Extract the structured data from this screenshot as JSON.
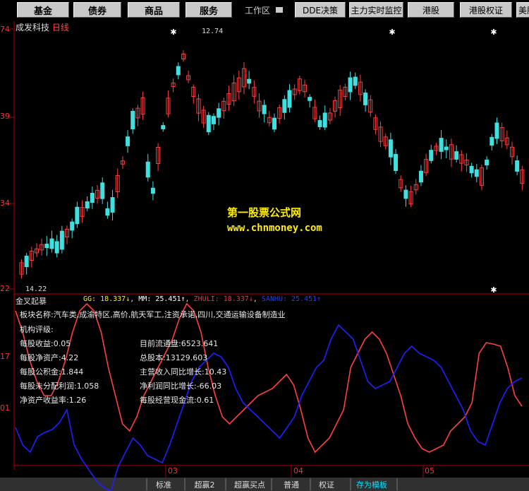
{
  "toolbar": {
    "buttons": [
      "基金",
      "债券",
      "商品",
      "服务"
    ],
    "workarea": "工作区",
    "right_buttons": [
      "DDE决策",
      "主力实时监控",
      "港股",
      "港股权证",
      "美股"
    ]
  },
  "chart_header": {
    "name": "成发科技",
    "period": "日线"
  },
  "price_axis": [
    "74",
    "39",
    "34",
    "22"
  ],
  "markers": {
    "high": "12.74",
    "low": "14.22"
  },
  "watermark": {
    "line1": "第一股票公式网",
    "line2": "www.chnmoney.com"
  },
  "indicator": {
    "name": "金叉起暴",
    "values": [
      {
        "label": "GG: 18.337↓",
        "color": "#ffee00"
      },
      {
        "label": "MM: 25.451↑",
        "color": "#ffffff"
      },
      {
        "label": "ZHULI: 18.337↓",
        "color": "#ff3030"
      },
      {
        "label": "SANHU: 25.451↑",
        "color": "#2040ff"
      }
    ],
    "axis": [
      "17",
      "01"
    ]
  },
  "info": {
    "sector": "板块名称:汽车类,成渝特区,高价,航天军工,注资承诺,四川,交通运输设备制造业",
    "rating": "机构评级:",
    "rows": [
      [
        "每股收益:0.05",
        "目前流通盘:6523.641"
      ],
      [
        "每股净资产:4.22",
        "总股本:13129.603"
      ],
      [
        "每股公积金:1.844",
        "主营收入同比增长:10.43"
      ],
      [
        "每股未分配利润:1.058",
        "净利润同比增长:-66.03"
      ],
      [
        "净资产收益率:1.26",
        "每股经营现金流:0.61"
      ]
    ]
  },
  "x_axis": [
    "03",
    "04",
    "05"
  ],
  "tabs": [
    "标准",
    "超赢2",
    "超赢买点",
    "普通",
    "权证",
    "存为模板"
  ],
  "colors": {
    "up": "#ff4040",
    "down": "#40e0e0",
    "zhuli": "#ff4040",
    "sanhu": "#2020ff",
    "grid": "#b00000"
  }
}
